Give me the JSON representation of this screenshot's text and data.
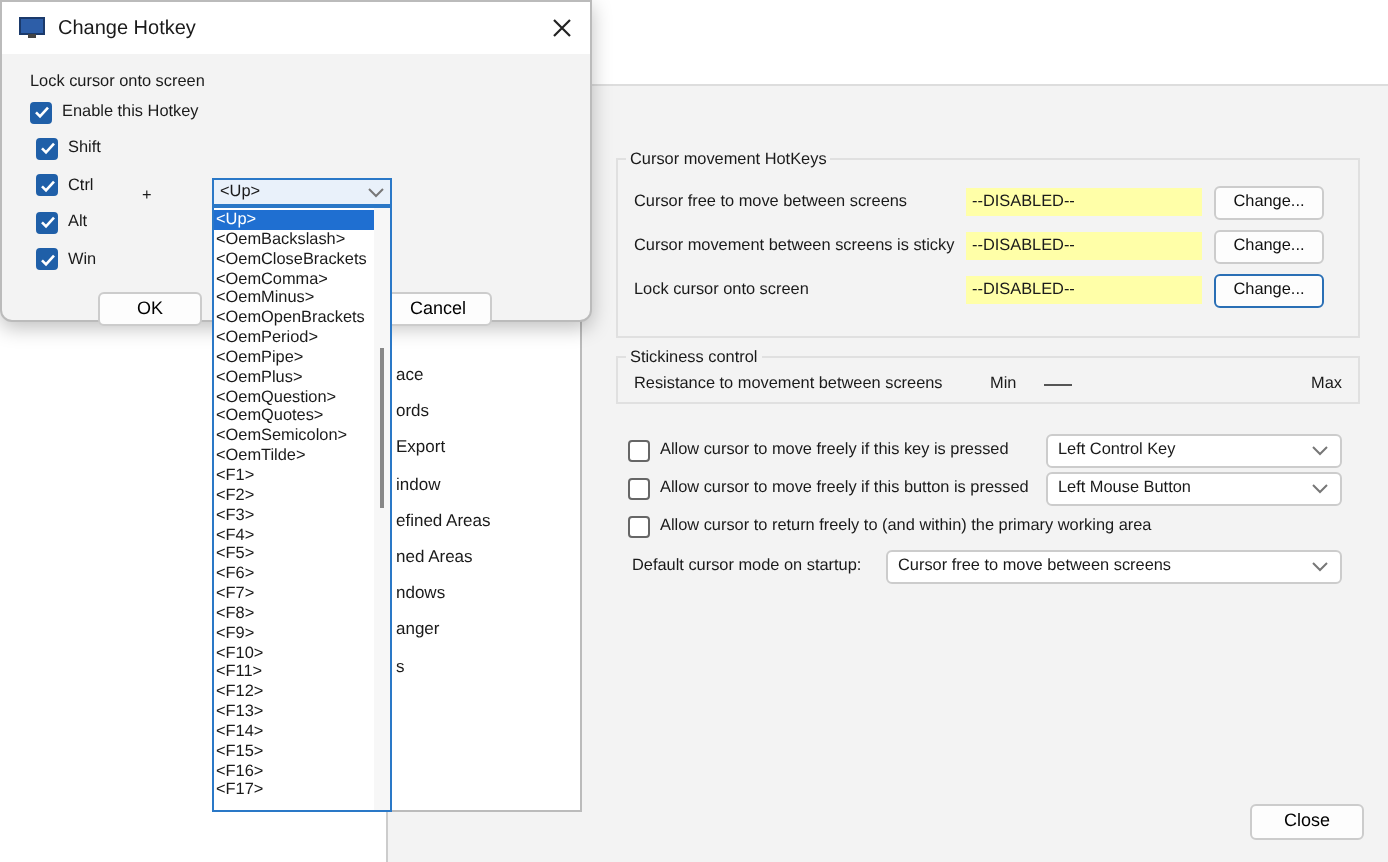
{
  "dialog": {
    "title": "Change Hotkey",
    "heading": "Lock cursor onto screen",
    "enable": {
      "label": "Enable this Hotkey",
      "checked": true
    },
    "modifiers": [
      {
        "label": "Shift",
        "checked": true
      },
      {
        "label": "Ctrl",
        "checked": true
      },
      {
        "label": "Alt",
        "checked": true
      },
      {
        "label": "Win",
        "checked": true
      }
    ],
    "plus": "+",
    "key_select": {
      "value": "<Up>",
      "options": [
        {
          "label": "<Up>",
          "selected": true
        },
        {
          "label": "<OemBackslash>",
          "selected": false
        },
        {
          "label": "<OemCloseBrackets",
          "selected": false
        },
        {
          "label": "<OemComma>",
          "selected": false
        },
        {
          "label": "<OemMinus>",
          "selected": false
        },
        {
          "label": "<OemOpenBrackets",
          "selected": false
        },
        {
          "label": "<OemPeriod>",
          "selected": false
        },
        {
          "label": "<OemPipe>",
          "selected": false
        },
        {
          "label": "<OemPlus>",
          "selected": false
        },
        {
          "label": "<OemQuestion>",
          "selected": false
        },
        {
          "label": "<OemQuotes>",
          "selected": false
        },
        {
          "label": "<OemSemicolon>",
          "selected": false
        },
        {
          "label": "<OemTilde>",
          "selected": false
        },
        {
          "label": "<F1>",
          "selected": false
        },
        {
          "label": "<F2>",
          "selected": false
        },
        {
          "label": "<F3>",
          "selected": false
        },
        {
          "label": "<F4>",
          "selected": false
        },
        {
          "label": "<F5>",
          "selected": false
        },
        {
          "label": "<F6>",
          "selected": false
        },
        {
          "label": "<F7>",
          "selected": false
        },
        {
          "label": "<F8>",
          "selected": false
        },
        {
          "label": "<F9>",
          "selected": false
        },
        {
          "label": "<F10>",
          "selected": false
        },
        {
          "label": "<F11>",
          "selected": false
        },
        {
          "label": "<F12>",
          "selected": false
        },
        {
          "label": "<F13>",
          "selected": false
        },
        {
          "label": "<F14>",
          "selected": false
        },
        {
          "label": "<F15>",
          "selected": false
        },
        {
          "label": "<F16>",
          "selected": false
        },
        {
          "label": "<F17>",
          "selected": false
        }
      ]
    },
    "buttons": [
      "OK",
      "Cancel"
    ]
  },
  "main_window": {
    "tree_items": [
      "ace",
      "ords",
      "Export",
      "indow",
      "efined Areas",
      "ned Areas",
      "ndows",
      "anger",
      "s"
    ],
    "hotkeys": {
      "title": "Cursor movement HotKeys",
      "rows": [
        {
          "label": "Cursor free to move between screens",
          "value": "--DISABLED--",
          "button": "Change...",
          "focused": false
        },
        {
          "label": "Cursor movement between screens is sticky",
          "value": "--DISABLED--",
          "button": "Change...",
          "focused": false
        },
        {
          "label": "Lock cursor onto screen",
          "value": "--DISABLED--",
          "button": "Change...",
          "focused": true
        }
      ]
    },
    "stickiness": {
      "title": "Stickiness control",
      "label": "Resistance to movement between screens",
      "min": "Min",
      "max": "Max"
    },
    "options": [
      {
        "kind": "checkbox-select",
        "label": "Allow cursor to move freely if this key is pressed",
        "checked": false,
        "value": "Left Control Key"
      },
      {
        "kind": "checkbox-select",
        "label": "Allow cursor to move freely if this button is pressed",
        "checked": false,
        "value": "Left Mouse Button"
      },
      {
        "kind": "checkbox",
        "label": "Allow cursor to return freely to (and within) the primary working area",
        "checked": false
      },
      {
        "kind": "label-select",
        "label": "Default cursor mode on startup:",
        "value": "Cursor free to move between screens"
      }
    ],
    "close": "Close"
  }
}
